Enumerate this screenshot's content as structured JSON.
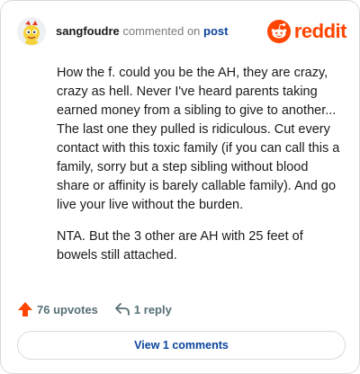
{
  "header": {
    "username": "sangfoudre",
    "verb": "commented on",
    "post_link": "post",
    "logo_text": "reddit",
    "avatar_icon": "snoo-avatar-icon",
    "brand_color": "#ff4500"
  },
  "comment": {
    "paragraphs": [
      "How the f. could you be the AH, they are crazy, crazy as hell. Never I've heard parents taking earned money from a sibling to give to another... The last one they pulled is ridiculous. Cut every contact with this toxic family (if you can call this a family, sorry but a step sibling without blood share or affinity is barely callable family). And go live your live without the burden.",
      "NTA. But the 3 other are AH with 25 feet of bowels still attached."
    ]
  },
  "actions": {
    "upvotes": "76 upvotes",
    "replies": "1 reply",
    "upvote_icon": "upvote-arrow-icon",
    "reply_icon": "reply-arrow-icon"
  },
  "footer": {
    "view_comments": "View 1 comments"
  }
}
